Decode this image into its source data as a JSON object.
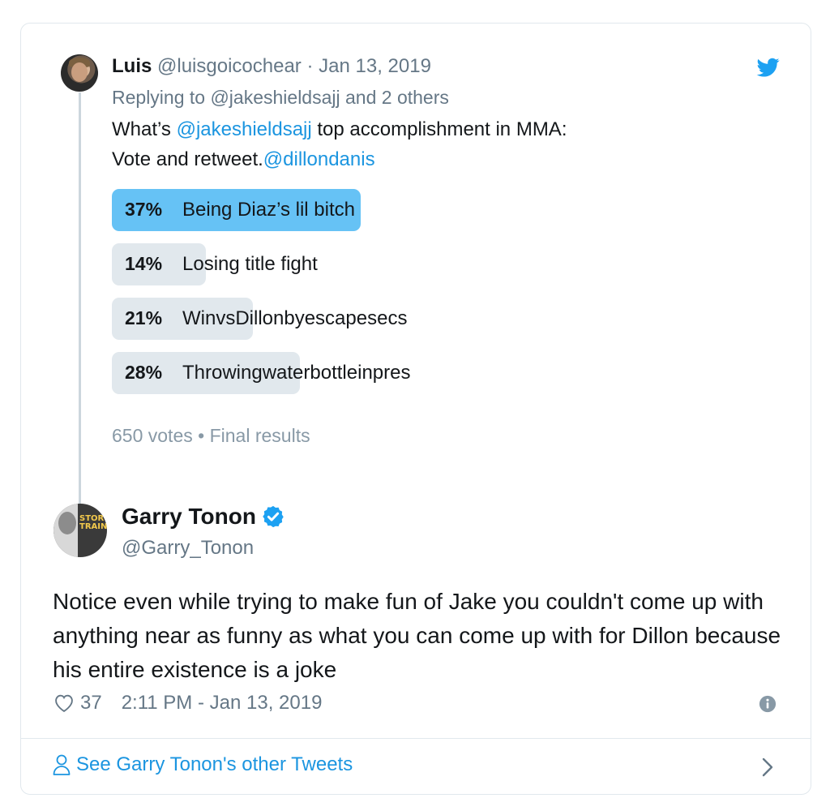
{
  "parent_tweet": {
    "name": "Luis",
    "handle": "@luisgoicochear",
    "separator": "·",
    "date": "Jan 13, 2019",
    "replying_to": "Replying to @jakeshieldsajj and 2 others",
    "text_line1_pre": "What’s ",
    "text_line1_mention": "@jakeshieldsajj",
    "text_line1_post": " top accomplishment in MMA:",
    "text_line2_pre": "Vote and retweet.",
    "text_line2_mention": "@dillondanis",
    "poll": {
      "options": [
        {
          "percent_label": "37%",
          "label": "Being Diaz’s lil bitch",
          "fraction": 0.37,
          "winner": true
        },
        {
          "percent_label": "14%",
          "label": "Losing title fight",
          "fraction": 0.14,
          "winner": false
        },
        {
          "percent_label": "21%",
          "label": "WinvsDillonbyescapesecs",
          "fraction": 0.21,
          "winner": false
        },
        {
          "percent_label": "28%",
          "label": "Throwingwaterbottleinpres",
          "fraction": 0.28,
          "winner": false
        }
      ],
      "votes": "650 votes",
      "bullet": "•",
      "status": "Final results"
    }
  },
  "main_tweet": {
    "name": "Garry Tonon",
    "handle": "@Garry_Tonon",
    "avatar_text": "STORY TRAINING",
    "text": "Notice even while trying to make fun of Jake you couldn't come up with anything near as funny as what you can come up with for Dillon because his entire existence is a joke",
    "likes": "37",
    "timestamp": "2:11 PM - Jan 13, 2019"
  },
  "footer": {
    "see_more": "See Garry Tonon's other Tweets"
  },
  "colors": {
    "link": "#1b95e0",
    "poll_winner": "#66c2f5",
    "poll_other": "#e1e8ed",
    "verified": "#1da1f2"
  },
  "icons": [
    "twitter-logo-icon",
    "verified-badge-icon",
    "heart-icon",
    "info-icon",
    "person-icon",
    "chevron-right-icon"
  ]
}
